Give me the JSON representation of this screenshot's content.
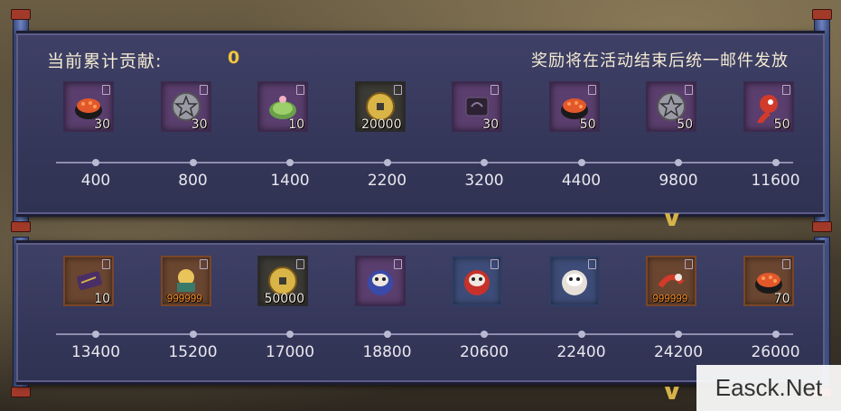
{
  "header": {
    "contribution_label": "当前累计贡献:",
    "contribution_value": "0",
    "note": "奖励将在活动结束后统一邮件发放"
  },
  "rewards_top": [
    {
      "icon": "salmon-roe-sushi-icon",
      "count": "30",
      "frame": "purple"
    },
    {
      "icon": "silver-pentagram-coin-icon",
      "count": "30",
      "frame": "purple"
    },
    {
      "icon": "sakura-mochi-icon",
      "count": "10",
      "frame": "purple"
    },
    {
      "icon": "gold-coin-icon",
      "count": "20000",
      "frame": "dark"
    },
    {
      "icon": "dark-talisman-icon",
      "count": "30",
      "frame": "purple"
    },
    {
      "icon": "salmon-roe-sushi-icon",
      "count": "50",
      "frame": "purple"
    },
    {
      "icon": "silver-pentagram-coin-icon",
      "count": "50",
      "frame": "purple"
    },
    {
      "icon": "red-magatama-icon",
      "count": "50",
      "frame": "purple"
    }
  ],
  "milestones_top": [
    "400",
    "800",
    "1400",
    "2200",
    "3200",
    "4400",
    "9800",
    "11600"
  ],
  "rewards_bottom": [
    {
      "icon": "purple-scroll-icon",
      "count": "10",
      "frame": "orange"
    },
    {
      "icon": "shikigami-material-icon",
      "count": "999999",
      "frame": "orange"
    },
    {
      "icon": "gold-coin-icon",
      "count": "50000",
      "frame": "dark"
    },
    {
      "icon": "blue-daruma-icon",
      "count": "",
      "frame": "purple"
    },
    {
      "icon": "red-daruma-icon",
      "count": "",
      "frame": "blue"
    },
    {
      "icon": "white-daruma-icon",
      "count": "",
      "frame": "blue"
    },
    {
      "icon": "red-dragon-material-icon",
      "count": "999999",
      "frame": "orange"
    },
    {
      "icon": "salmon-roe-sushi-icon",
      "count": "70",
      "frame": "orange"
    }
  ],
  "milestones_bottom": [
    "13400",
    "15200",
    "17000",
    "18800",
    "20600",
    "22400",
    "24200",
    "26000"
  ],
  "watermark": "Easck.Net",
  "colors": {
    "panel": "#3a3c60",
    "value": "#f2c53a",
    "text": "#f3ead2"
  }
}
